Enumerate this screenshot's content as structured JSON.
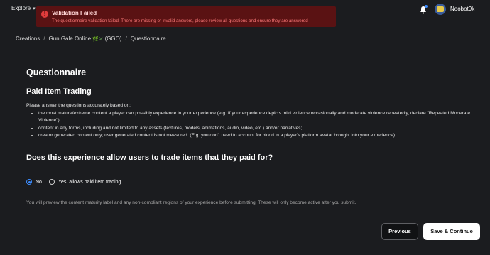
{
  "topbar": {
    "explore_label": "Explore",
    "username": "Noobot9k"
  },
  "alert": {
    "title": "Validation Failed",
    "message": "The questionnaire validation failed. There are missing or invalid answers, please review all questions and ensure they are answered"
  },
  "breadcrumb": {
    "items": [
      "Creations",
      "Gun Gale Online",
      "(GGO)",
      "Questionnaire"
    ],
    "emoji": "🌿⚔"
  },
  "page": {
    "title": "Questionnaire",
    "section_title": "Paid Item Trading",
    "instructions_intro": "Please answer the questions accurately based on:",
    "instructions_bullets": [
      "the most mature/extreme content a player can possibly experience in your experience (e.g. If your experience depicts mild violence occasionally and moderate violence repeatedly, declare \"Repeated Moderate Violence\");",
      "content in any forms, including and not limited to any assets (textures, models, animations, audio, video, etc.) and/or narratives;",
      "creator generated content only; user generated content is not measured. (E.g. you don't need to account for blood in a player's platform avatar brought into your experience)"
    ],
    "question": "Does this experience allow users to trade items that they paid for?",
    "options": [
      {
        "label": "No",
        "selected": true
      },
      {
        "label": "Yes, allows paid item trading",
        "selected": false
      }
    ],
    "footnote": "You will preview the content maturity label and any non-compliant regions of your experience before submitting. These will only become active after you submit."
  },
  "actions": {
    "previous_label": "Previous",
    "next_label": "Save & Continue"
  },
  "colors": {
    "background": "#1b1c1f",
    "alert_bg": "#5a1213",
    "accent": "#3c8cff"
  }
}
